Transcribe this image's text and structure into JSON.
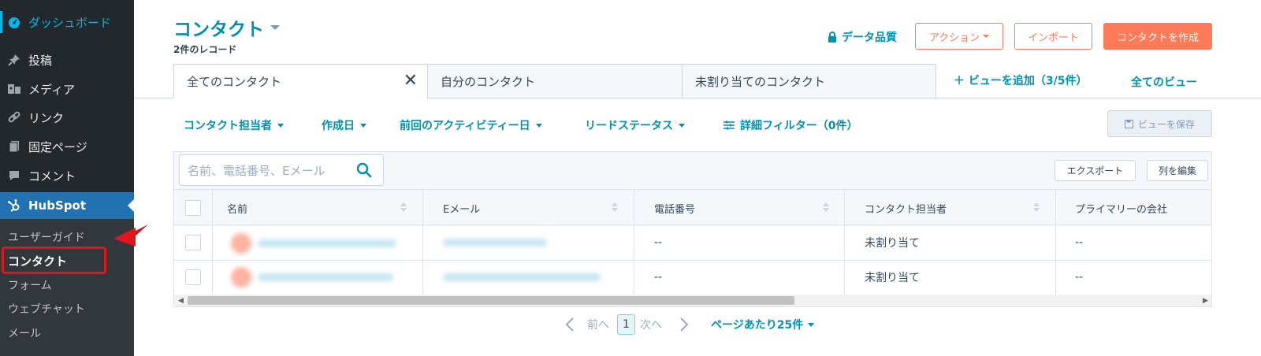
{
  "wp_sidebar": {
    "dashboard": "ダッシュボード",
    "posts": "投稿",
    "media": "メディア",
    "links": "リンク",
    "pages": "固定ページ",
    "comments": "コメント",
    "hubspot": "HubSpot",
    "sub_items": [
      "ユーザーガイド",
      "コンタクト",
      "フォーム",
      "ウェブチャット",
      "メール"
    ]
  },
  "header": {
    "title": "コンタクト",
    "records": "2件のレコード",
    "data_quality": "データ品質",
    "action_button": "アクション",
    "import_button": "インポート",
    "create_button": "コンタクトを作成"
  },
  "view_tabs": {
    "tabs": [
      "全てのコンタクト",
      "自分のコンタクト",
      "未割り当てのコンタクト"
    ],
    "add_view": "＋ ビューを追加（3/5件）",
    "all_views": "全てのビュー"
  },
  "filters": {
    "owner": "コンタクト担当者",
    "created": "作成日",
    "last_activity": "前回のアクティビティー日",
    "lead_status": "リードステータス",
    "advanced": "詳細フィルター（0件）",
    "save_view": "ビューを保存"
  },
  "table": {
    "search_placeholder": "名前、電話番号、Eメール",
    "export": "エクスポート",
    "edit_columns": "列を編集",
    "columns": [
      "名前",
      "Eメール",
      "電話番号",
      "コンタクト担当者",
      "プライマリーの会社"
    ],
    "rows": [
      {
        "phone": "--",
        "owner": "未割り当て",
        "company": "--"
      },
      {
        "phone": "--",
        "owner": "未割り当て",
        "company": "--"
      }
    ]
  },
  "pagination": {
    "prev": "前へ",
    "page": "1",
    "next": "次へ",
    "per_page": "ページあたり25件"
  },
  "colors": {
    "accent": "#0091ae",
    "orange": "#ff7a59",
    "wp_dark": "#23282d",
    "wp_blue": "#2271b1",
    "highlight_red": "#e0161e"
  }
}
